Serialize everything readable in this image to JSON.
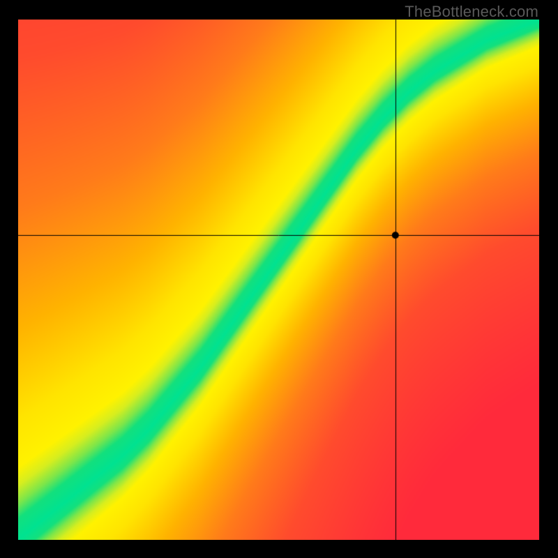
{
  "watermark": {
    "text": "TheBottleneck.com"
  },
  "chart_data": {
    "type": "heatmap",
    "title": "",
    "xlabel": "",
    "ylabel": "",
    "xlim": [
      0,
      100
    ],
    "ylim": [
      0,
      100
    ],
    "crosshair": {
      "x": 72.5,
      "y": 58.5
    },
    "marker": {
      "x": 72.5,
      "y": 58.5,
      "radius_px": 5,
      "color": "#000000"
    },
    "color_stops": [
      {
        "distance": 0.0,
        "color": "#00e291"
      },
      {
        "distance": 3.5,
        "color": "#13e07d"
      },
      {
        "distance": 6.0,
        "color": "#7de64a"
      },
      {
        "distance": 9.0,
        "color": "#d6ee1f"
      },
      {
        "distance": 12.0,
        "color": "#fff200"
      },
      {
        "distance": 20.0,
        "color": "#ffe400"
      },
      {
        "distance": 35.0,
        "color": "#ffb300"
      },
      {
        "distance": 55.0,
        "color": "#ff7b1a"
      },
      {
        "distance": 80.0,
        "color": "#ff4b2d"
      },
      {
        "distance": 120.0,
        "color": "#ff2a3b"
      }
    ],
    "ridge": {
      "description": "Optimal band center (green) as y(x), 0-100 scale",
      "points": [
        {
          "x": 0,
          "y": 0
        },
        {
          "x": 5,
          "y": 4
        },
        {
          "x": 10,
          "y": 8
        },
        {
          "x": 15,
          "y": 12
        },
        {
          "x": 20,
          "y": 16
        },
        {
          "x": 25,
          "y": 21
        },
        {
          "x": 30,
          "y": 27
        },
        {
          "x": 35,
          "y": 33
        },
        {
          "x": 40,
          "y": 40
        },
        {
          "x": 45,
          "y": 47
        },
        {
          "x": 50,
          "y": 54
        },
        {
          "x": 55,
          "y": 61
        },
        {
          "x": 60,
          "y": 68
        },
        {
          "x": 65,
          "y": 75
        },
        {
          "x": 70,
          "y": 81
        },
        {
          "x": 75,
          "y": 86
        },
        {
          "x": 80,
          "y": 90
        },
        {
          "x": 85,
          "y": 93
        },
        {
          "x": 90,
          "y": 96
        },
        {
          "x": 95,
          "y": 98
        },
        {
          "x": 100,
          "y": 100
        }
      ],
      "band_width": 5.0
    },
    "grid": false,
    "legend": null
  }
}
